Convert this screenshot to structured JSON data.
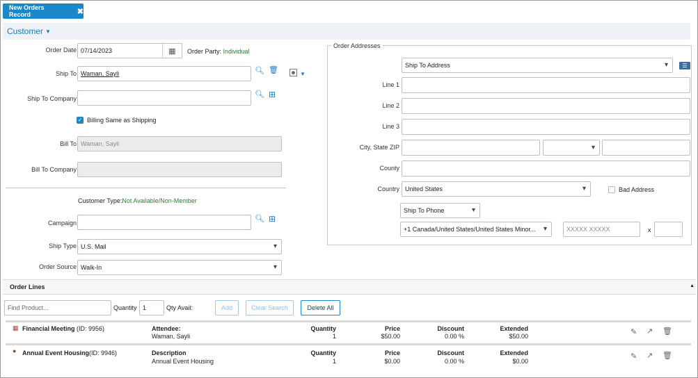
{
  "tab": {
    "label": "New Orders Record"
  },
  "section": {
    "title": "Customer"
  },
  "form": {
    "order_date_label": "Order Date",
    "order_date_value": "07/14/2023",
    "order_party_label": "Order Party:",
    "order_party_value": "Individual",
    "ship_to_label": "Ship To",
    "ship_to_value": "Waman, Sayli",
    "ship_to_company_label": "Ship To Company",
    "ship_to_company_value": "",
    "billing_same_label": "Billing Same as Shipping",
    "billing_same_checked": true,
    "bill_to_label": "Bill To",
    "bill_to_value": "Waman, Sayli",
    "bill_to_company_label": "Bill To Company",
    "bill_to_company_value": "",
    "customer_type_label": "Customer Type:",
    "customer_type_value": "Not Available/Non-Member",
    "campaign_label": "Campaign",
    "campaign_value": "",
    "ship_type_label": "Ship Type",
    "ship_type_value": "U.S. Mail",
    "order_source_label": "Order Source",
    "order_source_value": "Walk-In"
  },
  "addresses": {
    "legend": "Order Addresses",
    "address_type": "Ship To Address",
    "line1_label": "Line 1",
    "line2_label": "Line 2",
    "line3_label": "Line 3",
    "city_state_zip_label": "City, State ZIP",
    "county_label": "County",
    "country_label": "Country",
    "country_value": "United States",
    "bad_address_label": "Bad Address",
    "phone_type": "Ship To Phone",
    "phone_country": "+1 Canada/United States/United States Minor...",
    "phone_placeholder": "XXXXX XXXXX",
    "ext_label": "x"
  },
  "order_lines": {
    "title": "Order Lines",
    "find_placeholder": "Find Product...",
    "quantity_label": "Quantity",
    "quantity_value": "1",
    "qty_avail_label": "Qty Avail:",
    "add_label": "Add",
    "clear_label": "Clear Search",
    "delete_all_label": "Delete All",
    "items": [
      {
        "name": "Financial Meeting",
        "id": "(ID: 9956)",
        "detail_header": "Attendee:",
        "detail_value": "Waman, Sayli",
        "quantity_header": "Quantity",
        "quantity": "1",
        "price_header": "Price",
        "price": "$50.00",
        "discount_header": "Discount",
        "discount": "0.00 %",
        "extended_header": "Extended",
        "extended": "$50.00"
      },
      {
        "name": "Annual Event Housing",
        "id": "(ID: 9946)",
        "detail_header": "Description",
        "detail_value": "Annual Event Housing",
        "quantity_header": "Quantity",
        "quantity": "1",
        "price_header": "Price",
        "price": "$0.00",
        "discount_header": "Discount",
        "discount": "0.00 %",
        "extended_header": "Extended",
        "extended": "$0.00"
      }
    ]
  },
  "colors": {
    "accent": "#1a87c9",
    "positive": "#2e7d32"
  }
}
